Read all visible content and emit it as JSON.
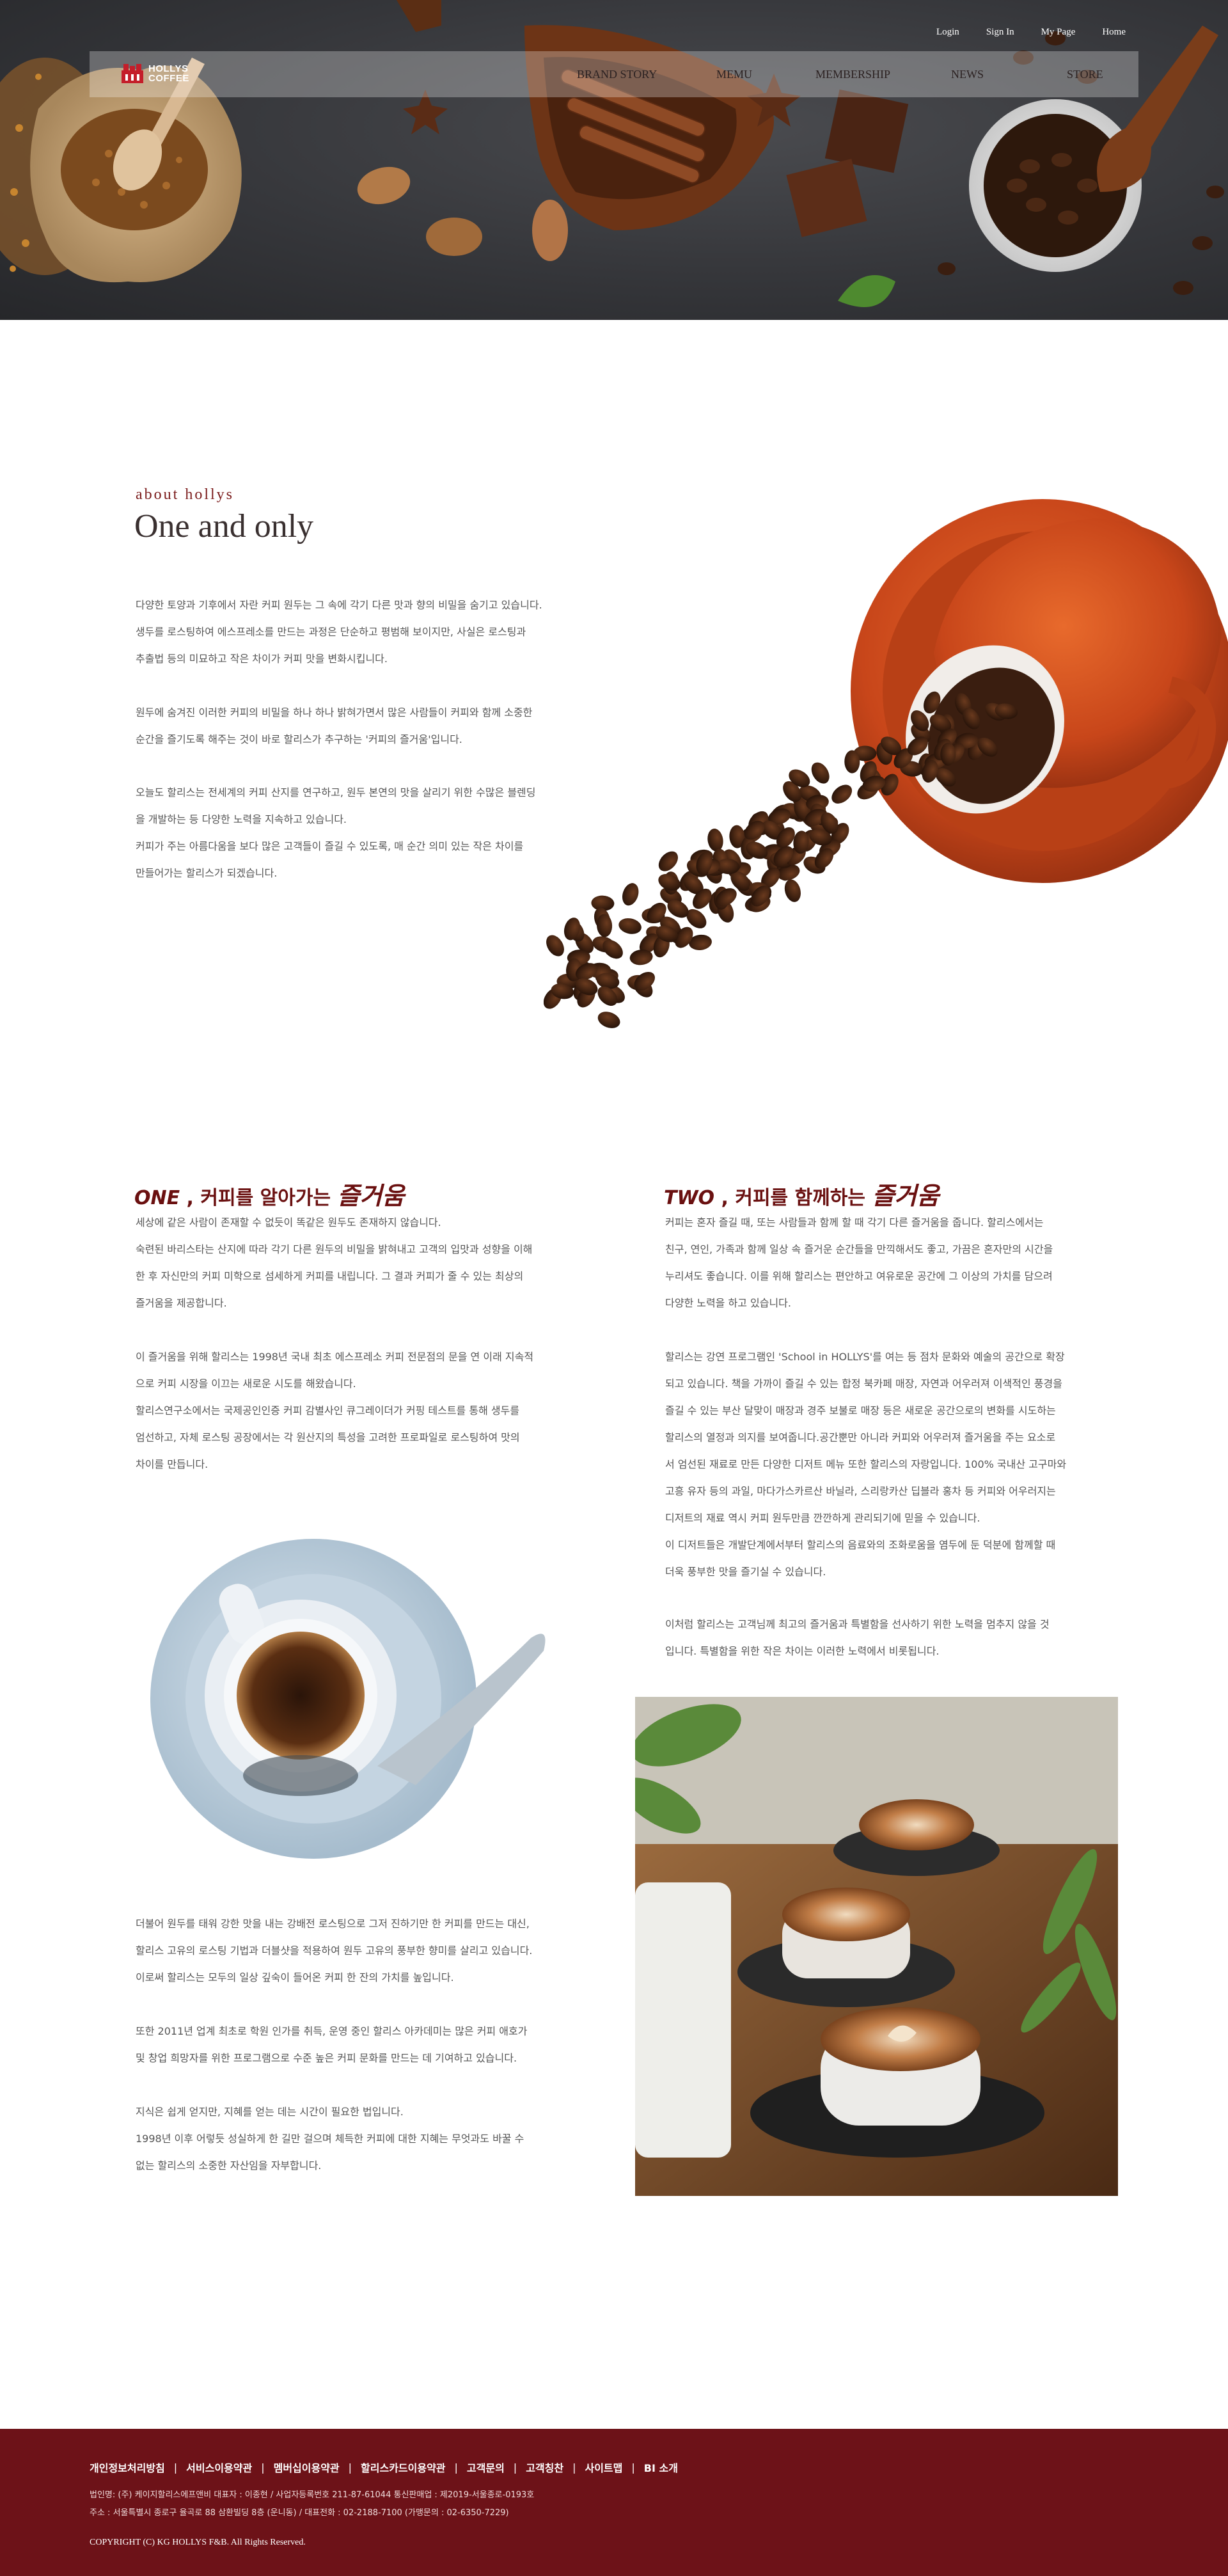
{
  "header": {
    "utility_links": [
      "Login",
      "Sign In",
      "My Page",
      "Home"
    ],
    "logo_text": [
      "HOLLYS",
      "COFFEE"
    ],
    "menu": [
      "BRAND STORY",
      "MEMU",
      "MEMBERSHIP",
      "NEWS",
      "STORE"
    ]
  },
  "about": {
    "subtitle": "about hollys",
    "title": "One and only",
    "paragraphs": [
      "다양한 토양과 기후에서 자란 커피 원두는 그 속에 각기 다른 맛과 향의 비밀을 숨기고 있습니다.\n생두를 로스팅하여 에스프레소를 만드는 과정은 단순하고 평범해 보이지만, 사실은 로스팅과\n추출법 등의 미묘하고 작은 차이가 커피 맛을 변화시킵니다.",
      "원두에 숨겨진 이러한 커피의 비밀을 하나 하나 밝혀가면서 많은 사람들이 커피와 함께 소중한\n순간을 즐기도록 해주는 것이 바로 할리스가 추구하는 '커피의 즐거움'입니다.",
      "오늘도 할리스는 전세계의 커피 산지를 연구하고, 원두 본연의 맛을 살리기 위한 수많은 블렌딩\n을 개발하는 등 다양한 노력을 지속하고 있습니다.\n커피가 주는 아름다움을 보다 많은 고객들이 즐길 수 있도록, 매 순간 의미 있는 작은 차이를\n만들어가는 할리스가 되겠습니다."
    ]
  },
  "one": {
    "num": "ONE",
    "comma": " , ",
    "mid": "커피를 알아가는 ",
    "big": "즐거움",
    "paragraphs": [
      "세상에 같은 사람이 존재할 수 없듯이 똑같은 원두도 존재하지 않습니다.\n숙련된 바리스타는 산지에 따라 각기 다른 원두의 비밀을 밝혀내고 고객의 입맛과 성향을 이해\n한 후 자신만의 커피 미학으로 섬세하게 커피를 내립니다. 그 결과 커피가 줄 수 있는 최상의\n즐거움을 제공합니다.",
      "이 즐거움을 위해 할리스는 1998년 국내 최초 에스프레소 커피 전문점의 문을 연 이래 지속적\n으로 커피 시장을 이끄는 새로운 시도를 해왔습니다.\n할리스연구소에서는 국제공인인증 커피 감별사인 큐그레이더가 커핑 테스트를 통해 생두를\n엄선하고, 자체 로스팅 공장에서는 각 원산지의 특성을 고려한 프로파일로 로스팅하여 맛의\n 차이를 만듭니다.",
      "더불어 원두를 태워 강한 맛을 내는 강배전 로스팅으로 그저 진하기만 한 커피를 만드는 대신,\n할리스 고유의 로스팅 기법과 더블샷을 적용하여 원두 고유의 풍부한 향미를 살리고 있습니다.\n이로써 할리스는 모두의 일상 깊숙이 들어온 커피 한 잔의 가치를 높입니다.",
      "또한 2011년 업계 최초로 학원 인가를 취득, 운영 중인 할리스 아카데미는 많은 커피 애호가\n및 창업 희망자를 위한 프로그램으로 수준 높은 커피 문화를 만드는 데 기여하고 있습니다.",
      "지식은 쉽게 얻지만, 지혜를 얻는 데는 시간이 필요한 법입니다.\n1998년 이후 어렇듯 성실하게 한 길만 걸으며 체득한 커피에 대한 지혜는 무엇과도 바꿀 수\n 없는 할리스의 소중한 자산임을 자부합니다."
    ]
  },
  "two": {
    "num": "TWO",
    "comma": " , ",
    "mid": "커피를 함께하는 ",
    "big": "즐거움",
    "paragraphs": [
      "커피는 혼자 즐길 때, 또는 사람들과 함께 할 때 각기 다른 즐거움을 줍니다. 할리스에서는\n친구, 연인, 가족과 함께 일상 속 즐거운 순간들을 만끽해서도 좋고, 가끔은 혼자만의 시간을\n누리셔도 좋습니다. 이를 위해 할리스는 편안하고 여유로운 공간에 그 이상의 가치를 담으려\n다양한 노력을 하고 있습니다.",
      "할리스는 강연 프로그램인 'School in HOLLYS'를 여는 등 점차 문화와 예술의 공간으로 확장\n되고 있습니다. 책을 가까이 즐길 수 있는 합정 북카페 매장, 자연과 어우러져 이색적인 풍경을\n즐길 수 있는 부산 달맞이 매장과 경주 보불로 매장 등은 새로운 공간으로의 변화를 시도하는\n할리스의 열정과 의지를 보여줍니다.공간뿐만 아니라 커피와 어우러져 즐거움을 주는 요소로\n서 엄선된 재료로 만든 다양한 디저트 메뉴 또한 할리스의 자랑입니다. 100% 국내산 고구마와\n고흥 유자 등의 과일, 마다가스카르산 바닐라, 스리랑카산 딥블라 홍차 등 커피와 어우러지는\n디저트의 재료 역시 커피 원두만큼 깐깐하게 관리되기에 믿을 수 있습니다.\n이 디저트들은 개발단계에서부터 할리스의 음료와의 조화로움을 염두에 둔 덕분에 함께할 때\n더욱 풍부한 맛을 즐기실 수 있습니다.",
      "이처럼 할리스는 고객님께 최고의 즐거움과 특별함을 선사하기 위한 노력을 멈추지 않을 것\n입니다. 특별함을 위한 작은 차이는 이러한 노력에서 비롯됩니다."
    ]
  },
  "footer": {
    "links": [
      "개인정보처리방침",
      "서비스이용약관",
      "멤버십이용약관",
      "할리스카드이용약관",
      "고객문의",
      "고객칭찬",
      "사이트맵",
      "BI 소개"
    ],
    "info_line1": "법인명: (주) 케이지할리스에프앤비 대표자 : 이종현    /    사업자등록번호 211-87-61044 통신판매업 : 제2019-서울종로-0193호",
    "info_line2": "주소 : 서울특별시 종로구 율곡로 88 삼환빌딩 8층 (운니동)    /    대표전화 : 02-2188-7100 (가맹문의 : 02-6350-7229)",
    "copyright": "COPYRIGHT (C) KG HOLLYS F&B. All Rights Reserved."
  }
}
